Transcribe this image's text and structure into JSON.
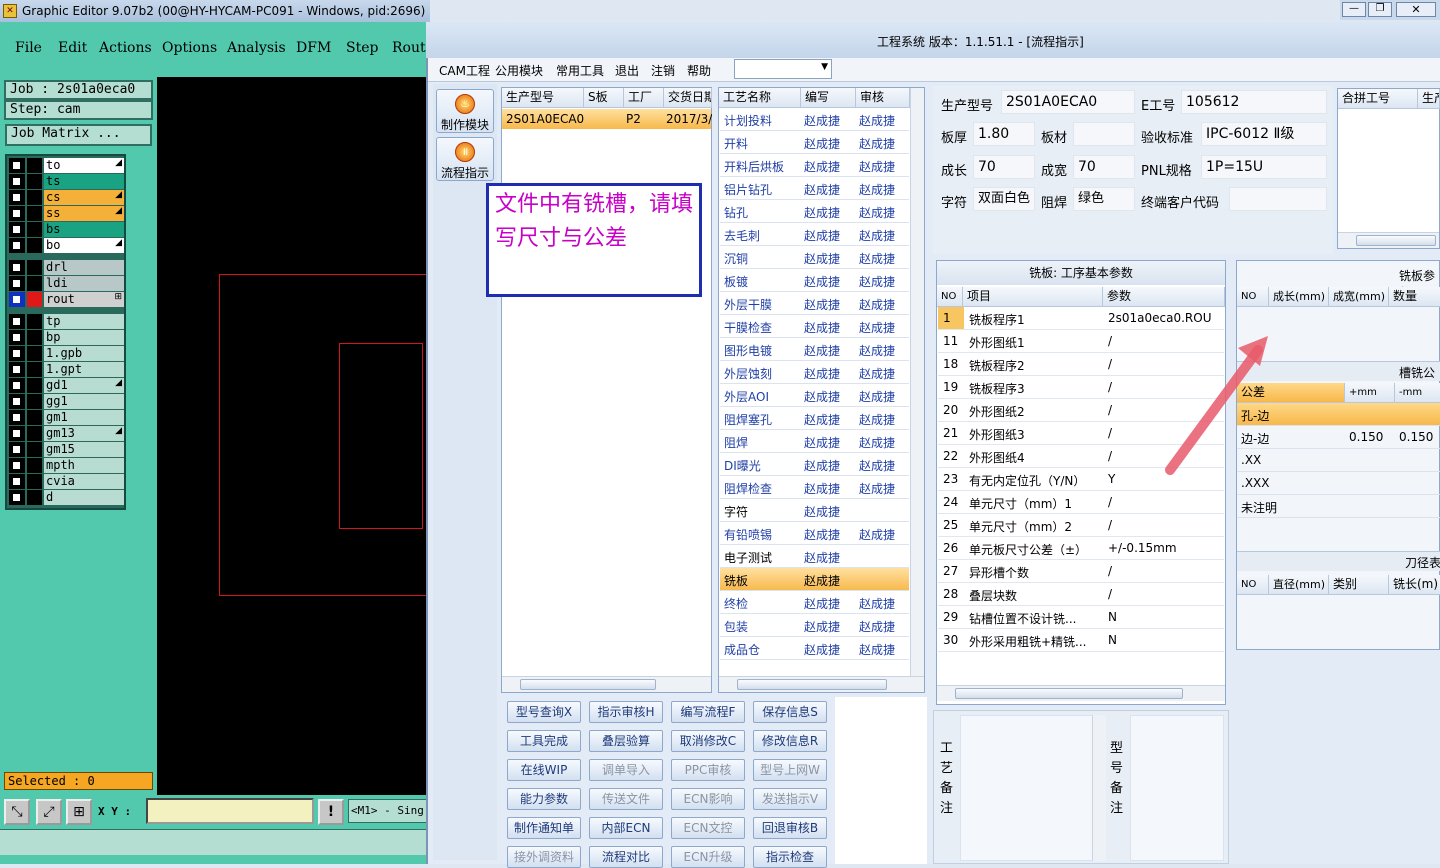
{
  "graphic_editor": {
    "title": "Graphic Editor 9.07b2 (00@HY-HYCAM-PC091 - Windows, pid:2696)",
    "menu": [
      "File",
      "Edit",
      "Actions",
      "Options",
      "Analysis",
      "DFM",
      "Step",
      "Rout"
    ],
    "job": "Job  : 2s01a0eca0",
    "step": "Step: cam",
    "job_matrix": "Job Matrix ...",
    "layers": [
      {
        "name": "to",
        "color": "#ffffff",
        "arrow": "◢"
      },
      {
        "name": "ts",
        "color": "#1aa382",
        "arrow": ""
      },
      {
        "name": "cs",
        "color": "#f5b03a",
        "arrow": "◢"
      },
      {
        "name": "ss",
        "color": "#f5b03a",
        "arrow": "◢"
      },
      {
        "name": "bs",
        "color": "#1aa382",
        "arrow": ""
      },
      {
        "name": "bo",
        "color": "#ffffff",
        "arrow": "◢"
      },
      {
        "name": "drl",
        "color": "#b8c8c8",
        "arrow": ""
      },
      {
        "name": "ldi",
        "color": "#b8c8c8",
        "arrow": ""
      },
      {
        "name": "rout",
        "color": "#d0d0d0",
        "arrow": "⊞"
      },
      {
        "name": "tp",
        "color": "#b8dcd2",
        "arrow": ""
      },
      {
        "name": "bp",
        "color": "#b8dcd2",
        "arrow": ""
      },
      {
        "name": "1.gpb",
        "color": "#b8dcd2",
        "arrow": ""
      },
      {
        "name": "1.gpt",
        "color": "#b8dcd2",
        "arrow": ""
      },
      {
        "name": "gd1",
        "color": "#b8dcd2",
        "arrow": "◢"
      },
      {
        "name": "gg1",
        "color": "#b8dcd2",
        "arrow": ""
      },
      {
        "name": "gm1",
        "color": "#b8dcd2",
        "arrow": ""
      },
      {
        "name": "gm13",
        "color": "#b8dcd2",
        "arrow": "◢"
      },
      {
        "name": "gm15",
        "color": "#b8dcd2",
        "arrow": ""
      },
      {
        "name": "mpth",
        "color": "#b8dcd2",
        "arrow": ""
      },
      {
        "name": "cvia",
        "color": "#b8dcd2",
        "arrow": ""
      },
      {
        "name": "d",
        "color": "#b8dcd2",
        "arrow": ""
      }
    ],
    "selected": "Selected : 0",
    "xy_label": "X Y :",
    "m1_label": "<M1> - Sing"
  },
  "main": {
    "title": "工程系统  版本：1.1.51.1 - [流程指示]",
    "menu": [
      "CAM工程",
      "公用模块",
      "常用工具",
      "退出",
      "注销",
      "帮助"
    ],
    "side_buttons": [
      "制作模块",
      "流程指示"
    ],
    "popup": "文件中有铣槽，请填写尺寸与公差",
    "order_table": {
      "headers": [
        "生产型号",
        "S板",
        "工厂",
        "交货日期"
      ],
      "row": [
        "2S01A0ECA0",
        "",
        "P2",
        "2017/3/"
      ]
    },
    "process_table": {
      "headers": [
        "工艺名称",
        "编写",
        "审核"
      ],
      "rows": [
        [
          "计划投料",
          "赵成捷",
          "赵成捷"
        ],
        [
          "开料",
          "赵成捷",
          "赵成捷"
        ],
        [
          "开料后烘板",
          "赵成捷",
          "赵成捷"
        ],
        [
          "铝片钻孔",
          "赵成捷",
          "赵成捷"
        ],
        [
          "钻孔",
          "赵成捷",
          "赵成捷"
        ],
        [
          "去毛刺",
          "赵成捷",
          "赵成捷"
        ],
        [
          "沉铜",
          "赵成捷",
          "赵成捷"
        ],
        [
          "板镀",
          "赵成捷",
          "赵成捷"
        ],
        [
          "外层干膜",
          "赵成捷",
          "赵成捷"
        ],
        [
          "干膜检查",
          "赵成捷",
          "赵成捷"
        ],
        [
          "图形电镀",
          "赵成捷",
          "赵成捷"
        ],
        [
          "外层蚀刻",
          "赵成捷",
          "赵成捷"
        ],
        [
          "外层AOI",
          "赵成捷",
          "赵成捷"
        ],
        [
          "阻焊塞孔",
          "赵成捷",
          "赵成捷"
        ],
        [
          "阻焊",
          "赵成捷",
          "赵成捷"
        ],
        [
          "DI曝光",
          "赵成捷",
          "赵成捷"
        ],
        [
          "阻焊检查",
          "赵成捷",
          "赵成捷"
        ],
        [
          "字符",
          "赵成捷",
          ""
        ],
        [
          "有铅喷锡",
          "赵成捷",
          "赵成捷"
        ],
        [
          "电子测试",
          "赵成捷",
          ""
        ],
        [
          "铣板",
          "赵成捷",
          ""
        ],
        [
          "终检",
          "赵成捷",
          "赵成捷"
        ],
        [
          "包装",
          "赵成捷",
          "赵成捷"
        ],
        [
          "成品仓",
          "赵成捷",
          "赵成捷"
        ]
      ]
    },
    "info": {
      "model_label": "生产型号",
      "model": "2S01A0ECA0",
      "eno_label": "E工号",
      "eno": "105612",
      "thick_label": "板厚",
      "thick": "1.80",
      "mat_label": "板材",
      "mat": "",
      "std_label": "验收标准",
      "std": "IPC-6012 Ⅱ级",
      "len_label": "成长",
      "len": "70",
      "wid_label": "成宽",
      "wid": "70",
      "pnl_label": "PNL规格",
      "pnl": "1P=15U",
      "char_label": "字符",
      "char": "双面白色",
      "mask_label": "阻焊",
      "mask": "绿色",
      "cust_label": "终端客户代码",
      "cust": ""
    },
    "merge_headers": [
      "合拼工号",
      "生产"
    ],
    "param_panel": {
      "title": "铣板: 工序基本参数",
      "headers": [
        "NO",
        "项目",
        "参数"
      ],
      "rows": [
        [
          "1",
          "铣板程序1",
          "2s01a0eca0.ROU"
        ],
        [
          "11",
          "外形图纸1",
          "/"
        ],
        [
          "18",
          "铣板程序2",
          "/"
        ],
        [
          "19",
          "铣板程序3",
          "/"
        ],
        [
          "20",
          "外形图纸2",
          "/"
        ],
        [
          "21",
          "外形图纸3",
          "/"
        ],
        [
          "22",
          "外形图纸4",
          "/"
        ],
        [
          "23",
          "有无内定位孔（Y/N）",
          "Y"
        ],
        [
          "24",
          "单元尺寸（mm）1",
          "/"
        ],
        [
          "25",
          "单元尺寸（mm）2",
          "/"
        ],
        [
          "26",
          "单元板尺寸公差（±）",
          "+/-0.15mm"
        ],
        [
          "27",
          "异形槽个数",
          "/"
        ],
        [
          "28",
          "叠层块数",
          "/"
        ],
        [
          "29",
          "钻槽位置不设计铣...",
          "N"
        ],
        [
          "30",
          "外形采用粗铣+精铣...",
          "N"
        ]
      ]
    },
    "mill_panel": {
      "title": "铣板参数",
      "headers": [
        "NO",
        "成长(mm)",
        "成宽(mm)",
        "数量"
      ]
    },
    "tol_panel": {
      "title": "槽铣公差",
      "headers": [
        "公差",
        "+mm",
        "-mm"
      ],
      "rows": [
        [
          "孔-边",
          "",
          ""
        ],
        [
          "边-边",
          "0.150",
          "0.150"
        ],
        [
          ".XX",
          "",
          ""
        ],
        [
          ".XXX",
          "",
          ""
        ],
        [
          "未注明",
          "",
          ""
        ]
      ]
    },
    "tool_panel": {
      "title": "刀径表",
      "headers": [
        "NO",
        "直径(mm)",
        "类别",
        "铣长(m)"
      ]
    },
    "buttons": [
      [
        "型号查询X",
        "指示审核H",
        "编写流程F",
        "保存信息S"
      ],
      [
        "工具完成",
        "叠层验算",
        "取消修改C",
        "修改信息R"
      ],
      [
        "在线WIP",
        "调单导入",
        "PPC审核",
        "型号上网W"
      ],
      [
        "能力参数",
        "传送文件",
        "ECN影响",
        "发送指示V"
      ],
      [
        "制作通知单",
        "内部ECN",
        "ECN文控",
        "回退审核B"
      ],
      [
        "接外调资料",
        "流程对比",
        "ECN升级",
        "指示检查"
      ]
    ],
    "disabled_buttons": [
      "调单导入",
      "PPC审核",
      "型号上网W",
      "传送文件",
      "ECN影响",
      "发送指示V",
      "ECN文控",
      "ECN升级",
      "接外调资料"
    ],
    "remarks": {
      "craft": "工艺备注",
      "model": "型号备注"
    }
  }
}
